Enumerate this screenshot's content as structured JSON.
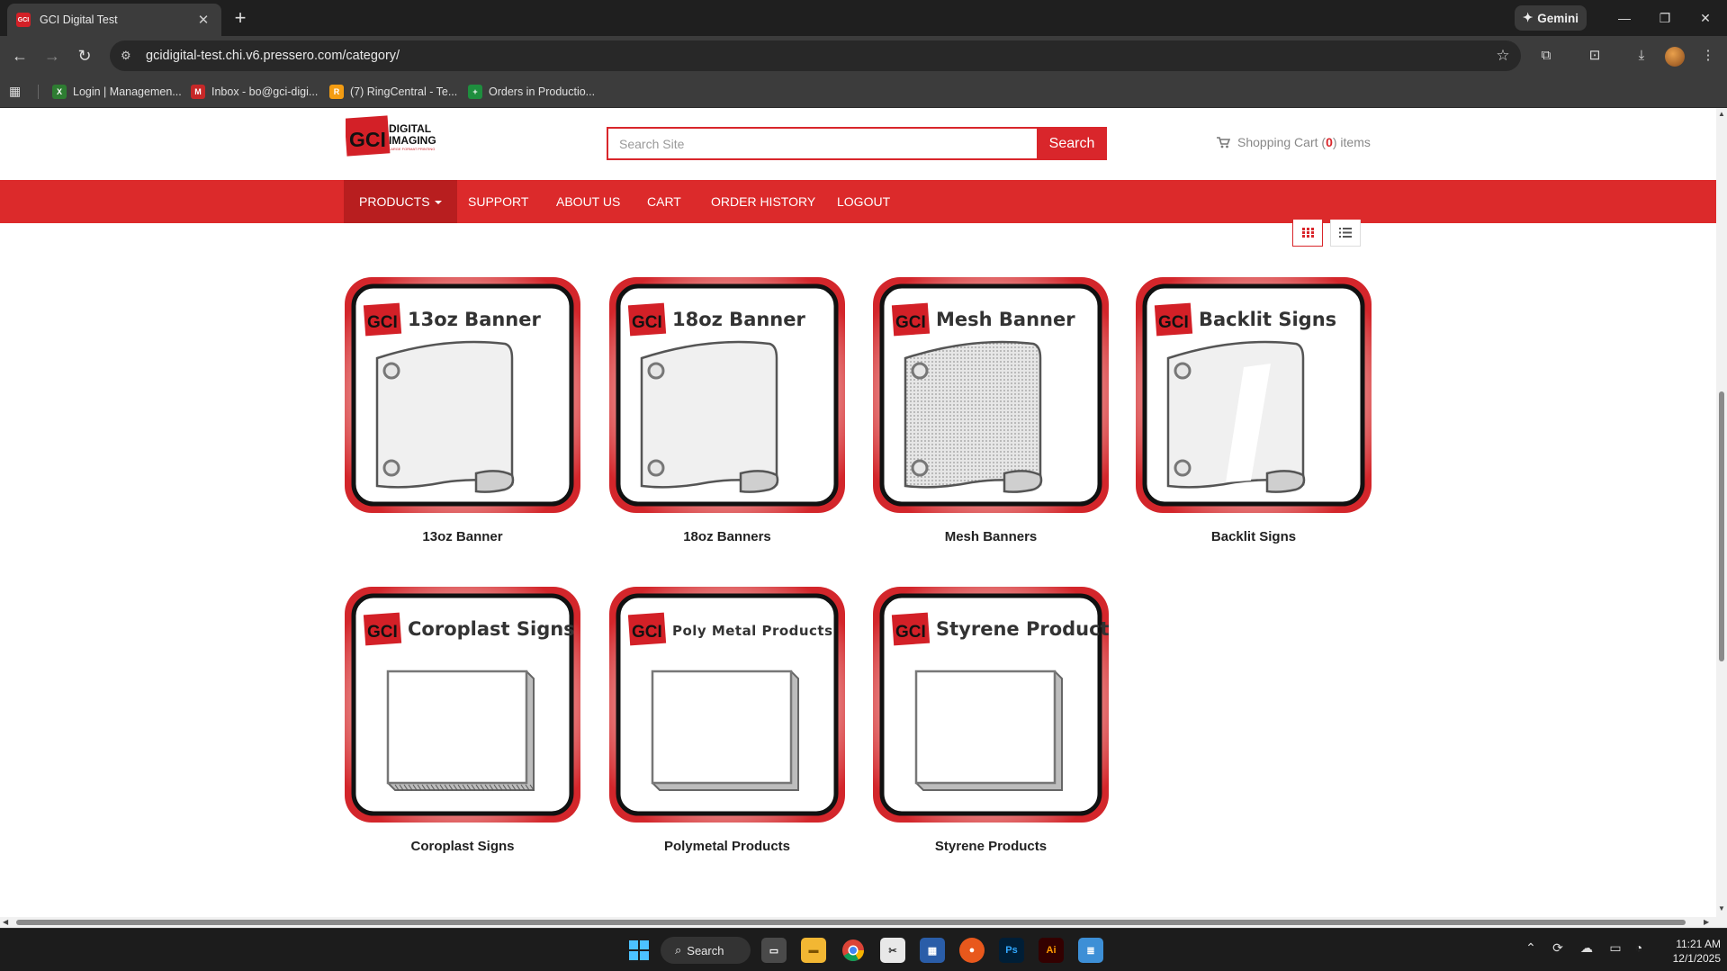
{
  "browser": {
    "tab_title": "GCI Digital Test",
    "tab_favicon_text": "GCI",
    "gemini_label": "Gemini",
    "url": "gcidigital-test.chi.v6.pressero.com/category/",
    "bookmarks": [
      {
        "label": "Login | Managemen...",
        "color": "#2e7d32",
        "glyph": "X"
      },
      {
        "label": "Inbox - bo@gci-digi...",
        "color": "#c62828",
        "glyph": "M"
      },
      {
        "label": "(7) RingCentral - Te...",
        "color": "#f39c12",
        "glyph": "R"
      },
      {
        "label": "Orders in Productio...",
        "color": "#1e8e3e",
        "glyph": "+"
      }
    ]
  },
  "site": {
    "logo": {
      "mark": "GCI",
      "line1": "DIGITAL",
      "line2": "IMAGING",
      "tagline": "LARGE FORMAT PRINTING"
    },
    "search": {
      "placeholder": "Search Site",
      "button": "Search"
    },
    "cart": {
      "prefix": "Shopping Cart (",
      "count": "0",
      "suffix": ") items"
    },
    "nav": [
      "PRODUCTS",
      "SUPPORT",
      "ABOUT US",
      "CART",
      "ORDER HISTORY",
      "LOGOUT"
    ],
    "accent_color": "#dc2a2b"
  },
  "products": [
    {
      "name": "13oz Banner",
      "card_title": "13oz Banner",
      "image": "banner"
    },
    {
      "name": "18oz Banners",
      "card_title": "18oz Banner",
      "image": "banner"
    },
    {
      "name": "Mesh Banners",
      "card_title": "Mesh Banner",
      "image": "mesh"
    },
    {
      "name": "Backlit Signs",
      "card_title": "Backlit Signs",
      "image": "backlit"
    },
    {
      "name": "Coroplast Signs",
      "card_title": "Coroplast Signs",
      "image": "coroplast"
    },
    {
      "name": "Polymetal Products",
      "card_title": "Poly Metal Products",
      "image": "polymetal"
    },
    {
      "name": "Styrene Products",
      "card_title": "Styrene Products",
      "image": "styrene"
    }
  ],
  "taskbar": {
    "search_label": "Search",
    "time": "11:21 AM",
    "date": "12/1/2025"
  }
}
